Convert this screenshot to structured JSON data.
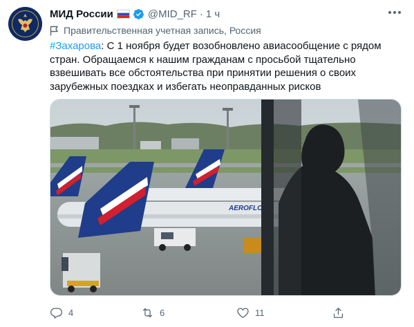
{
  "tweet": {
    "display_name": "МИД России",
    "handle": "@MID_RF",
    "separator": "·",
    "time": "1 ч",
    "gov_label": "Правительственная учетная запись, Россия",
    "hashtag": "#Захарова",
    "text": ": С 1 ноября будет возобновлено авиасообщение с рядом стран. Обращаемся к нашим гражданам с просьбой тщательно взвешивать все обстоятельства при принятии решения о своих зарубежных поездках и избегать неоправданных рисков",
    "media": {
      "airline_logo_text": "AEROFLOT",
      "icon": "photo-image"
    }
  },
  "actions": {
    "reply_count": "4",
    "retweet_count": "6",
    "like_count": "11"
  },
  "icons": {
    "avatar": "mfa-emblem-icon",
    "flag": "russia-flag-icon",
    "verified": "verified-badge-icon",
    "more": "more-dots-icon",
    "gov": "flag-outline-icon",
    "reply": "reply-icon",
    "retweet": "retweet-icon",
    "like": "heart-icon",
    "share": "share-icon"
  },
  "colors": {
    "accent": "#1d9bf0",
    "muted_text": "#536471",
    "primary_text": "#0f1419",
    "avatar_bg": "#0f2a63"
  }
}
